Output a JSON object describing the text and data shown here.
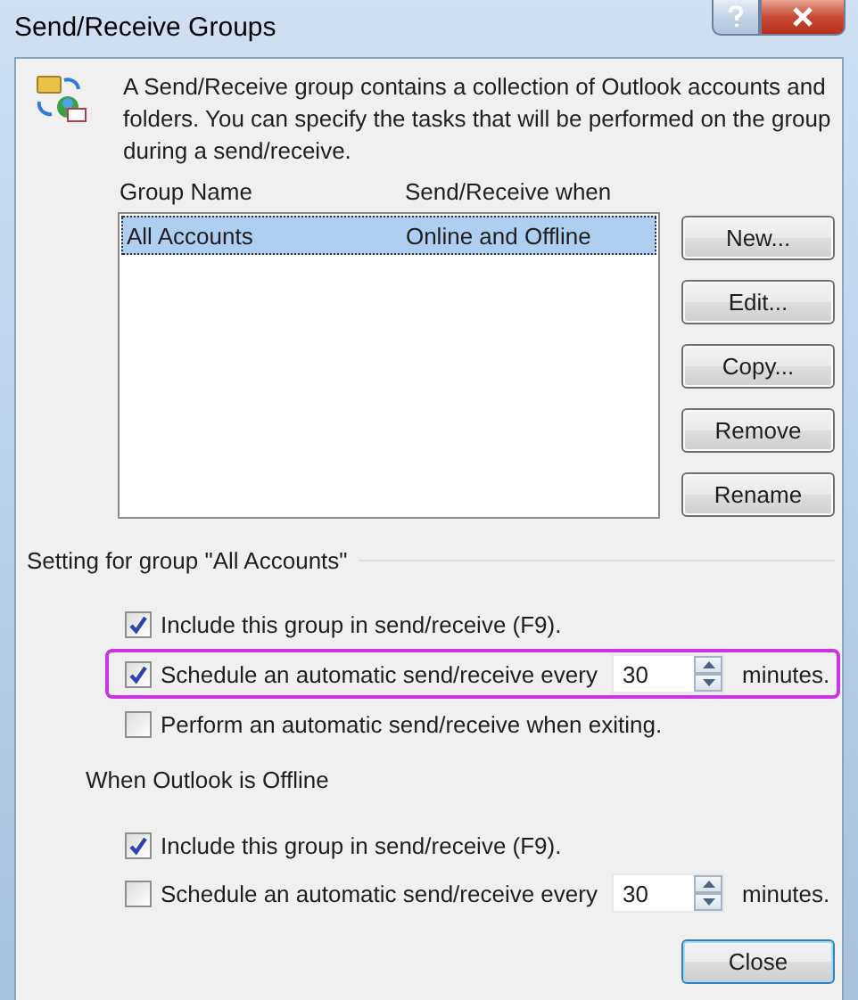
{
  "window": {
    "title": "Send/Receive Groups"
  },
  "intro": "A Send/Receive group contains a collection of Outlook accounts and folders. You can specify the tasks that will be performed on the group during a send/receive.",
  "table": {
    "columns": [
      "Group Name",
      "Send/Receive when"
    ],
    "rows": [
      {
        "cells": [
          "All Accounts",
          "Online and Offline"
        ],
        "selected": true
      }
    ]
  },
  "side_buttons": [
    "New...",
    "Edit...",
    "Copy...",
    "Remove",
    "Rename"
  ],
  "sections": [
    {
      "title": "Setting for group \"All Accounts\"",
      "kind": "group",
      "options": [
        {
          "kind": "checkbox",
          "label": "Include this group in send/receive (F9).",
          "checked": true,
          "highlighted": false
        },
        {
          "kind": "schedule",
          "label": "Schedule an automatic send/receive every",
          "checked": true,
          "value": "30",
          "unit": "minutes.",
          "highlighted": true
        },
        {
          "kind": "checkbox",
          "label": "Perform an automatic send/receive when exiting.",
          "checked": false,
          "highlighted": false
        }
      ]
    },
    {
      "title": "When Outlook is Offline",
      "kind": "plain",
      "options": [
        {
          "kind": "checkbox",
          "label": "Include this group in send/receive (F9).",
          "checked": true,
          "highlighted": false
        },
        {
          "kind": "schedule",
          "label": "Schedule an automatic send/receive every",
          "checked": false,
          "value": "30",
          "unit": "minutes.",
          "highlighted": false
        }
      ]
    }
  ],
  "close_button": "Close"
}
